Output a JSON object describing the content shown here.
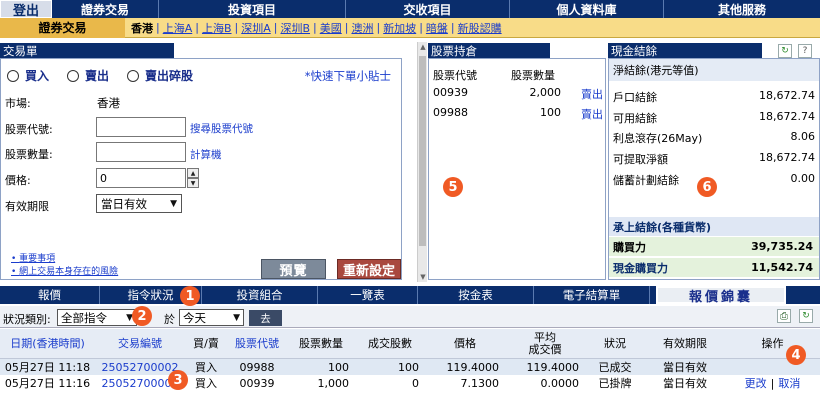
{
  "nav": {
    "logout": "登出",
    "items": [
      "證券交易",
      "投資項目",
      "交收項目",
      "個人資料庫",
      "其他服務"
    ]
  },
  "subnav": {
    "active": "證券交易",
    "markets": [
      "香港",
      "上海A",
      "上海B",
      "深圳A",
      "深圳B",
      "美國",
      "澳洲",
      "新加坡",
      "暗盤",
      "新股認購"
    ]
  },
  "order_panel": {
    "title": "交易單",
    "radios": [
      "買入",
      "賣出",
      "賣出碎股"
    ],
    "tips": "*快速下單小貼士",
    "market_label": "市場:",
    "market_value": "香港",
    "code_label": "股票代號:",
    "search_link": "搜尋股票代號",
    "qty_label": "股票數量:",
    "calc_link": "計算機",
    "price_label": "價格:",
    "price_value": "0",
    "validity_label": "有效期限",
    "validity_value": "當日有效",
    "notes": [
      "重要事項",
      "網上交易本身存在的風險"
    ],
    "preview_button": "預覽",
    "reset_button": "重新設定"
  },
  "holdings": {
    "title": "股票持倉",
    "col_code": "股票代號",
    "col_qty": "股票數量",
    "rows": [
      {
        "code": "00939",
        "qty": "2,000",
        "action": "賣出"
      },
      {
        "code": "09988",
        "qty": "100",
        "action": "賣出"
      }
    ]
  },
  "cash": {
    "title": "現金結餘",
    "subtitle": "淨結餘(港元等值)",
    "rows": [
      {
        "label": "戶口結餘",
        "value": "18,672.74"
      },
      {
        "label": "可用結餘",
        "value": "18,672.74"
      },
      {
        "label": "利息滾存(26May)",
        "value": "8.06"
      },
      {
        "label": "可提取淨額",
        "value": "18,672.74"
      },
      {
        "label": "儲蓄計劃結餘",
        "value": "0.00"
      }
    ],
    "carry_title": "承上結餘(各種貨幣)",
    "buying_power_label": "購買力",
    "buying_power_value": "39,735.24",
    "cash_buying_power_label": "現金購買力",
    "cash_buying_power_value": "11,542.74",
    "refresh_icon": "↻",
    "help_icon": "?"
  },
  "tabs": {
    "items": [
      "報價",
      "指令狀況",
      "投資組合",
      "一覽表",
      "按金表",
      "電子結算單"
    ],
    "quote_button": "報價錦囊"
  },
  "filter": {
    "status_label": "狀況類別:",
    "status_value": "全部指令",
    "at_label": "於",
    "date_value": "今天",
    "go_button": "去"
  },
  "order_table": {
    "headers": [
      "日期(香港時間)",
      "交易編號",
      "買/賣",
      "股票代號",
      "股票數量",
      "成交股數",
      "價格",
      "平均\n成交價",
      "狀況",
      "有效期限",
      "操作"
    ],
    "rows": [
      {
        "date": "05月27日 11:18",
        "ref": "25052700002",
        "side": "買入",
        "code": "09988",
        "qty": "100",
        "filled": "100",
        "price": "119.4000",
        "avg": "119.4000",
        "status": "已成交",
        "validity": "當日有效",
        "actions": []
      },
      {
        "date": "05月27日 11:16",
        "ref": "25052700002",
        "side": "買入",
        "code": "00939",
        "qty": "1,000",
        "filled": "0",
        "price": "7.1300",
        "avg": "0.0000",
        "status": "已掛牌",
        "validity": "當日有效",
        "actions": [
          "更改",
          "取消"
        ]
      }
    ]
  },
  "badges": [
    "1",
    "2",
    "3",
    "4",
    "5",
    "6"
  ]
}
